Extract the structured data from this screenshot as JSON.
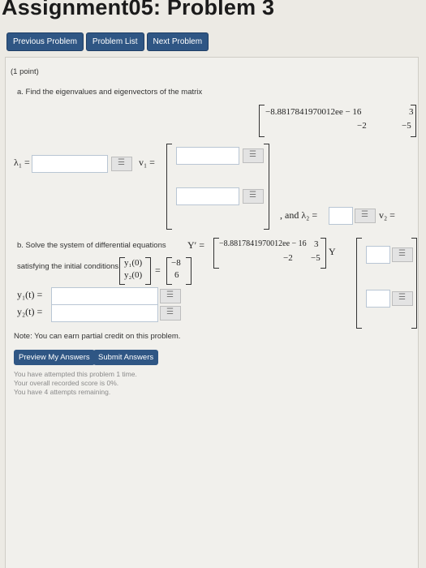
{
  "title": "Assignment05: Problem 3",
  "nav": {
    "previous": "Previous Problem",
    "list": "Problem List",
    "next": "Next Problem"
  },
  "problem": {
    "points": "(1 point)",
    "part_a": "a. Find the eigenvalues and eigenvectors of the matrix",
    "matrix_a": {
      "r1c1": "−8.8817841970012ee − 16",
      "r1c2": "3",
      "r2c1": "−2",
      "r2c2": "−5"
    },
    "lambda1": "λ₁ =",
    "v1": "v₁ =",
    "and": ", and λ₂ =",
    "v2": "v₂ =",
    "part_b": "b. Solve the system of differential equations",
    "yprime": "Y′ =",
    "matrix_b": {
      "r1c1": "−8.8817841970012ee − 16",
      "r1c2": "3",
      "r2c1": "−2",
      "r2c2": "−5"
    },
    "Y": "Y",
    "initial": "satisfying the initial conditions",
    "y0_top": "y₁(0)",
    "y0_bot": "y₂(0)",
    "eq": "=",
    "init_top": "−8",
    "init_bot": "6",
    "y1t": "y₁(t) =",
    "y2t": "y₂(t) ="
  },
  "note": "Note: You can earn partial credit on this problem.",
  "buttons": {
    "preview": "Preview My Answers",
    "submit": "Submit Answers"
  },
  "status": {
    "line1": "You have attempted this problem 1 time.",
    "line2": "Your overall recorded score is 0%.",
    "line3": "You have 4 attempts remaining."
  }
}
